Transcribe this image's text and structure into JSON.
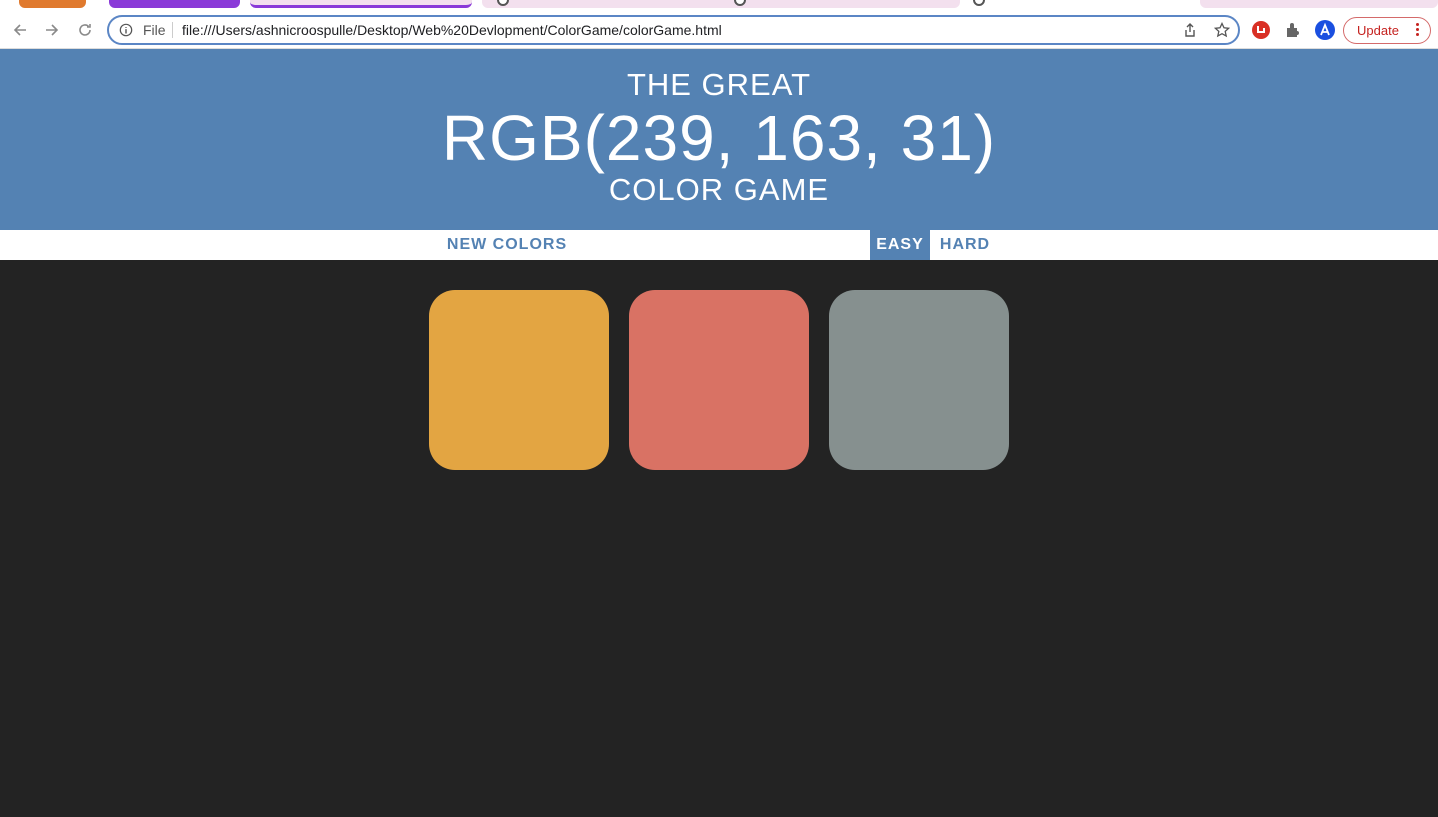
{
  "browser": {
    "file_label": "File",
    "url": "file:///Users/ashnicroospulle/Desktop/Web%20Devlopment/ColorGame/colorGame.html",
    "update_label": "Update"
  },
  "game": {
    "title_top": "THE GREAT",
    "rgb_display": "RGB(239, 163, 31)",
    "title_bottom": "COLOR GAME",
    "new_colors_label": "NEW COLORS",
    "easy_label": "EASY",
    "hard_label": "HARD",
    "header_color": "#5482b3",
    "background_color": "#232323",
    "squares": [
      {
        "color": "#e3a542"
      },
      {
        "color": "#d97264"
      },
      {
        "color": "#86908f"
      }
    ]
  }
}
